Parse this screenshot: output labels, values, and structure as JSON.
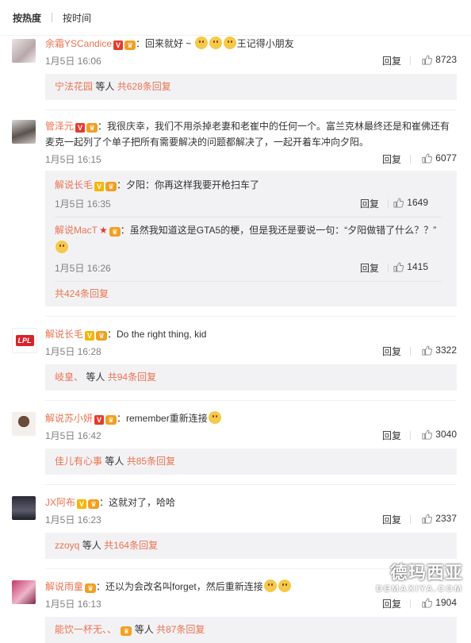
{
  "tabs": {
    "hot": "按热度",
    "time": "按时间"
  },
  "reply_label": "回复",
  "comments": [
    {
      "user": "余霜YSCandice",
      "text": "：回来就好 ~ ",
      "text_after": "王记得小朋友",
      "time": "1月5日 16:06",
      "likes": "8723",
      "subreply": {
        "user": "宁法花园",
        "tail": "等人",
        "count": "共628条回复"
      }
    },
    {
      "user": "管泽元",
      "text": "：我很庆幸，我们不用杀掉老妻和老崔中的任何一个。富兰克林最终还是和崔佛还有麦克一起列了个单子把所有需要解决的问题都解决了，一起开着车冲向夕阳。",
      "time": "1月5日 16:15",
      "likes": "6077",
      "nested": [
        {
          "user": "解说长毛",
          "text": "：夕阳：你再这样我要开枪扫车了",
          "time": "1月5日 16:35",
          "likes": "1649"
        },
        {
          "user": "解说MacT",
          "text": "：虽然我知道这是GTA5的梗，但是我还是要说一句：“夕阳做错了什么？？”",
          "time": "1月5日 16:26",
          "likes": "1415"
        }
      ],
      "more": "共424条回复"
    },
    {
      "user": "解说长毛",
      "text": "：Do the right thing, kid",
      "time": "1月5日 16:28",
      "likes": "3322",
      "avatar_text": "LPL",
      "subreply": {
        "user": "岐皇、",
        "tail": "等人",
        "count": "共94条回复"
      }
    },
    {
      "user": "解说苏小妍",
      "text": "：remember重新连接",
      "time": "1月5日 16:42",
      "likes": "3040",
      "subreply": {
        "user": "佳儿有心事",
        "tail": "等人",
        "count": "共85条回复"
      }
    },
    {
      "user": "JX阿布",
      "text": "：这就对了，哈哈",
      "time": "1月5日 16:23",
      "likes": "2337",
      "subreply": {
        "user": "zzoyq",
        "tail": "等人",
        "count": "共164条回复"
      }
    },
    {
      "user": "解说雨童",
      "text": "：还以为会改名叫forget，然后重新连接",
      "time": "1月5日 16:13",
      "likes": "1904",
      "subreply": {
        "user": "能饮一杯无、、",
        "tail": "等人",
        "count": "共87条回复"
      }
    }
  ],
  "watermark": {
    "cn": "德玛西亚",
    "en": "DEMAXIYA.COM"
  }
}
